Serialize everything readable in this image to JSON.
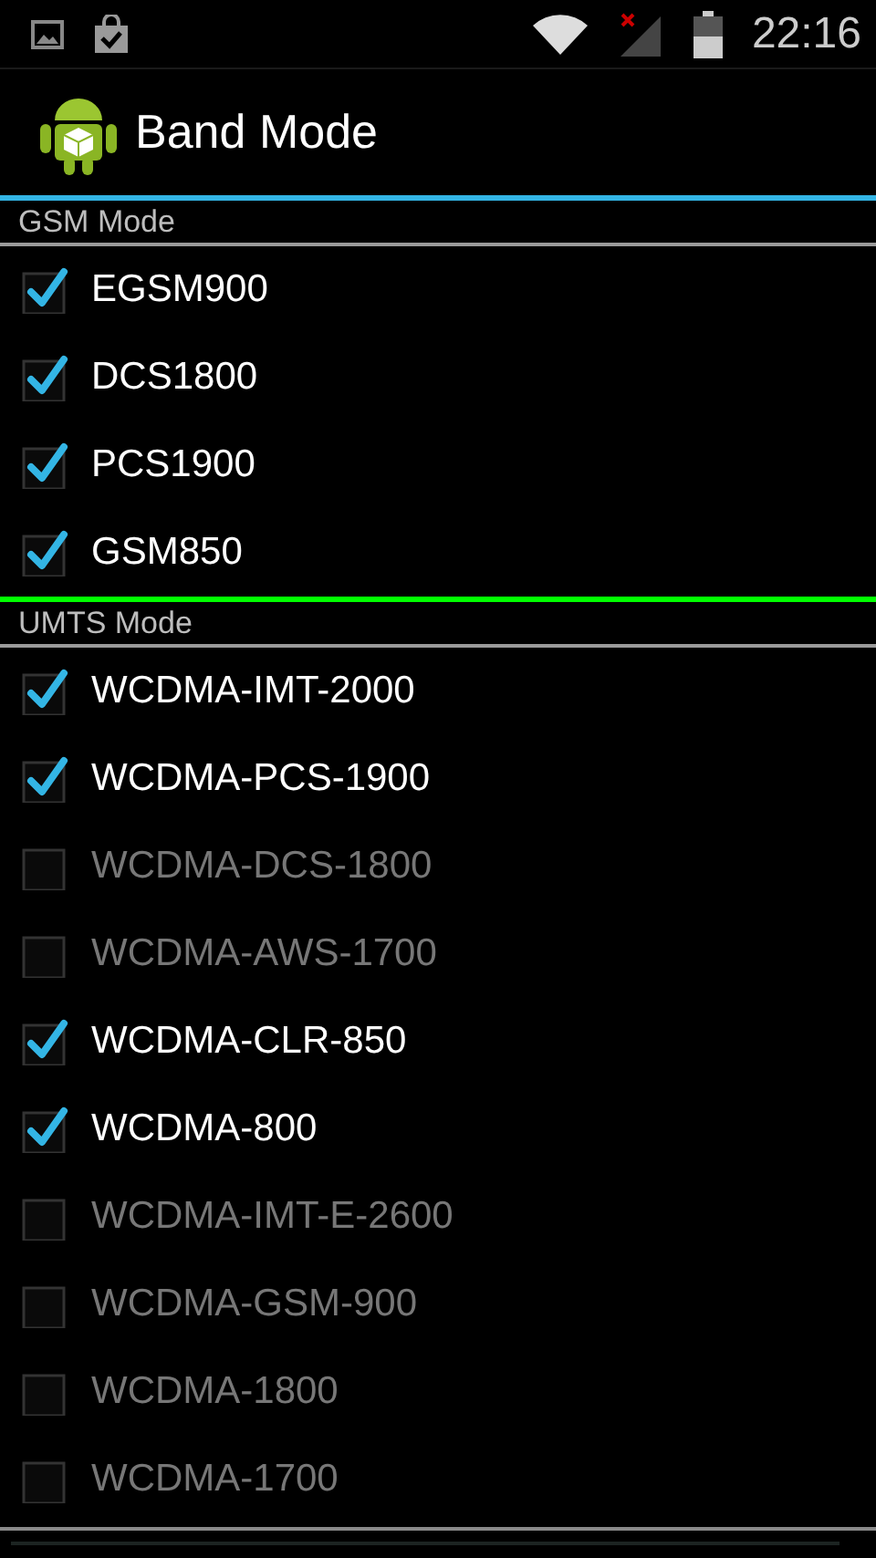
{
  "status_bar": {
    "time": "22:16"
  },
  "action_bar": {
    "title": "Band Mode"
  },
  "sections": [
    {
      "title": "GSM Mode",
      "color": "#33b5e5",
      "items": [
        {
          "label": "EGSM900",
          "checked": true
        },
        {
          "label": "DCS1800",
          "checked": true
        },
        {
          "label": "PCS1900",
          "checked": true
        },
        {
          "label": "GSM850",
          "checked": true
        }
      ]
    },
    {
      "title": "UMTS Mode",
      "color": "#00ff00",
      "items": [
        {
          "label": "WCDMA-IMT-2000",
          "checked": true
        },
        {
          "label": "WCDMA-PCS-1900",
          "checked": true
        },
        {
          "label": "WCDMA-DCS-1800",
          "checked": false
        },
        {
          "label": "WCDMA-AWS-1700",
          "checked": false
        },
        {
          "label": "WCDMA-CLR-850",
          "checked": true
        },
        {
          "label": "WCDMA-800",
          "checked": true
        },
        {
          "label": "WCDMA-IMT-E-2600",
          "checked": false
        },
        {
          "label": "WCDMA-GSM-900",
          "checked": false
        },
        {
          "label": "WCDMA-1800",
          "checked": false
        },
        {
          "label": "WCDMA-1700",
          "checked": false
        }
      ]
    }
  ]
}
